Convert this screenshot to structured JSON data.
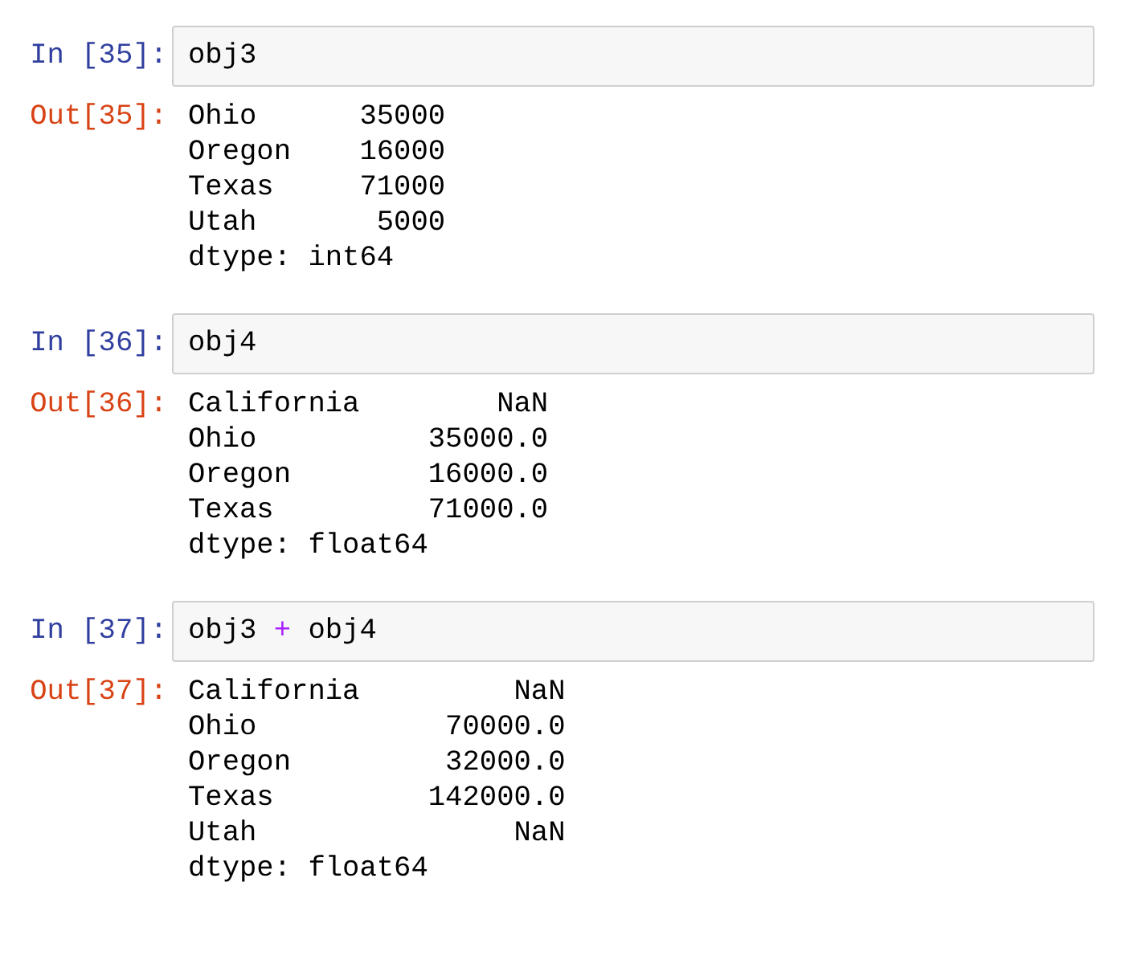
{
  "cells": [
    {
      "input_prompt": "In [35]:",
      "code": [
        {
          "kind": "name",
          "text": "obj3"
        }
      ],
      "output_prompt": "Out[35]:",
      "output_lines": [
        "Ohio      35000",
        "Oregon    16000",
        "Texas     71000",
        "Utah       5000",
        "dtype: int64"
      ]
    },
    {
      "input_prompt": "In [36]:",
      "code": [
        {
          "kind": "name",
          "text": "obj4"
        }
      ],
      "output_prompt": "Out[36]:",
      "output_lines": [
        "California        NaN",
        "Ohio          35000.0",
        "Oregon        16000.0",
        "Texas         71000.0",
        "dtype: float64"
      ]
    },
    {
      "input_prompt": "In [37]:",
      "code": [
        {
          "kind": "name",
          "text": "obj3 "
        },
        {
          "kind": "operator",
          "text": "+"
        },
        {
          "kind": "name",
          "text": " obj4"
        }
      ],
      "output_prompt": "Out[37]:",
      "output_lines": [
        "California         NaN",
        "Ohio           70000.0",
        "Oregon         32000.0",
        "Texas         142000.0",
        "Utah               NaN",
        "dtype: float64"
      ]
    }
  ]
}
